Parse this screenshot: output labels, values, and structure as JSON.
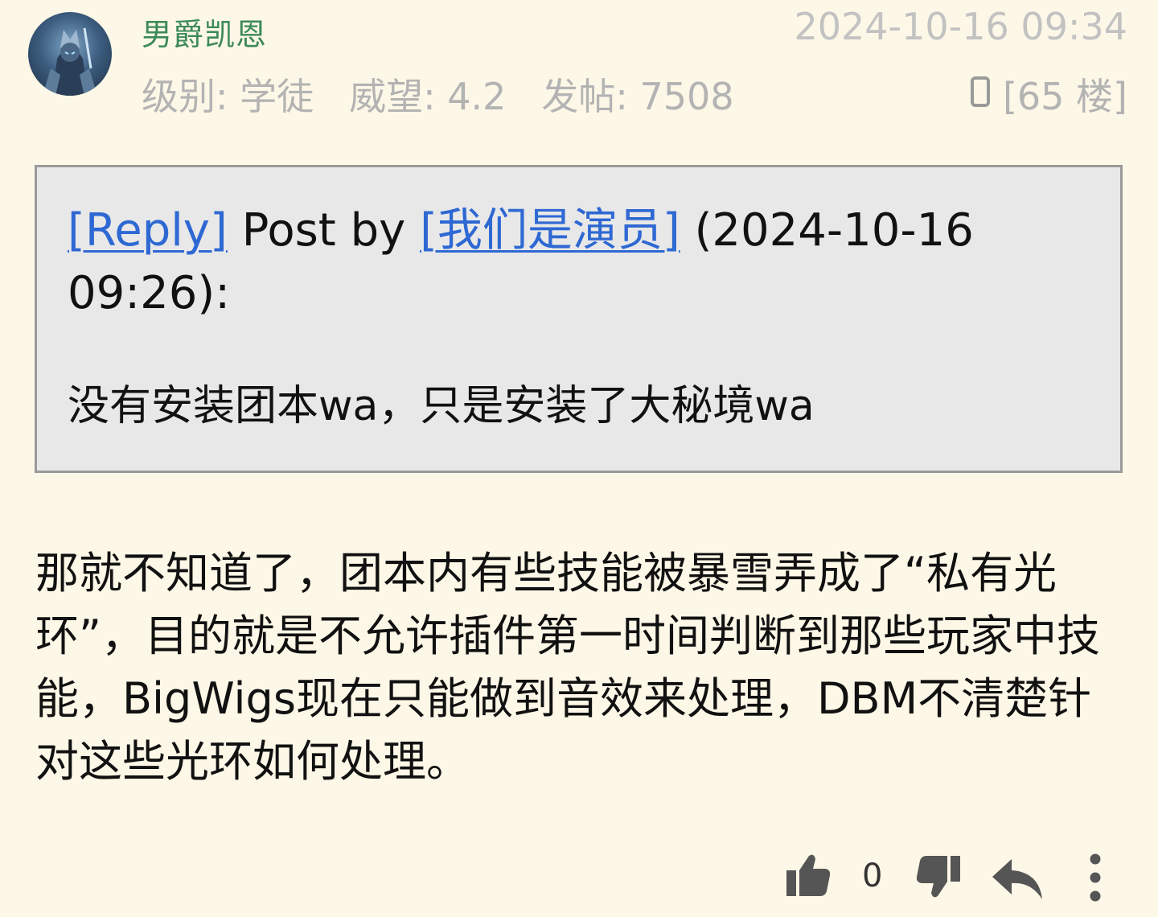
{
  "post": {
    "username": "男爵凯恩",
    "stats": {
      "level": "级别: 学徒",
      "prestige": "威望: 4.2",
      "posts": "发帖: 7508"
    },
    "timestamp": "2024-10-16 09:34",
    "floor": "[65 楼]"
  },
  "quote": {
    "reply_link": "[Reply]",
    "post_by": " Post by ",
    "author_link": "[我们是演员]",
    "date": " (2024-10-16 09:26):",
    "text": "没有安装团本wa，只是安装了大秘境wa"
  },
  "content": "那就不知道了，团本内有些技能被暴雪弄成了“私有光环”，目的就是不允许插件第一时间判断到那些玩家中技能，BigWigs现在只能做到音效来处理，DBM不清楚针对这些光环如何处理。",
  "actions": {
    "like_count": "0",
    "icons": [
      "thumbs-up-icon",
      "thumbs-down-icon",
      "reply-icon",
      "more-icon"
    ]
  },
  "colors": {
    "background": "#fdf7e7",
    "username": "#3c8a57",
    "link": "#2e68d3",
    "muted": "#b3b3b3",
    "quote_bg": "#e8e8e8"
  }
}
